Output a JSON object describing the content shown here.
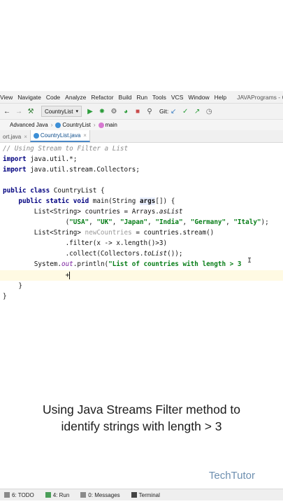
{
  "menu": {
    "items": [
      "View",
      "Navigate",
      "Code",
      "Analyze",
      "Refactor",
      "Build",
      "Run",
      "Tools",
      "VCS",
      "Window",
      "Help"
    ],
    "project": "JAVAPrograms - Co"
  },
  "toolbar": {
    "run_config": "CountryList",
    "git_label": "Git:"
  },
  "breadcrumbs": [
    "Advanced Java",
    "CountryList",
    "main"
  ],
  "tabs": [
    {
      "label": "ort.java"
    },
    {
      "label": "CountryList.java"
    }
  ],
  "code": {
    "l1": "// Using Stream to Filter a List",
    "l2_kw": "import",
    "l2_rest": " java.util.*;",
    "l3_kw": "import",
    "l3_rest": " java.util.stream.Collectors;",
    "l5_kw1": "public",
    "l5_kw2": "class",
    "l5_rest": " CountryList {",
    "l6_kw1": "public",
    "l6_kw2": "static",
    "l6_kw3": "void",
    "l6_a": " main(String ",
    "l6_args": "args",
    "l6_b": "[]) {",
    "l7_a": "List<String> countries = Arrays.",
    "l7_asList": "asList",
    "l8_open": "(",
    "s1": "\"USA\"",
    "s2": "\"UK\"",
    "s3": "\"Japan\"",
    "s4": "\"India\"",
    "s5": "\"Germany\"",
    "s6": "\"Italy\"",
    "l8_close": ");",
    "comma": ", ",
    "l9_a": "List<String> ",
    "l9_var": "newCountries",
    "l9_b": " = countries.stream()",
    "l10": ".filter(x -> x.length()>3)",
    "l11_a": ".collect(Collectors.",
    "l11_toList": "toList",
    "l11_b": "());",
    "l12_a": "System.",
    "l12_out": "out",
    "l12_b": ".println(",
    "l12_str": "\"List of countries with length > 3",
    "l13": "+",
    "l14": "}",
    "l15": "}"
  },
  "caption": {
    "line1": "Using Java Streams Filter method to",
    "line2": "identify strings with length > 3"
  },
  "brand": "TechTutor",
  "status": {
    "todo": "6: TODO",
    "run": "4: Run",
    "messages": "0: Messages",
    "terminal": "Terminal"
  },
  "colors": {
    "keyword": "#00007f",
    "string": "#067d17",
    "comment": "#8c8c8c",
    "caret_line": "#fffae3",
    "brand": "#6d8fb0"
  }
}
